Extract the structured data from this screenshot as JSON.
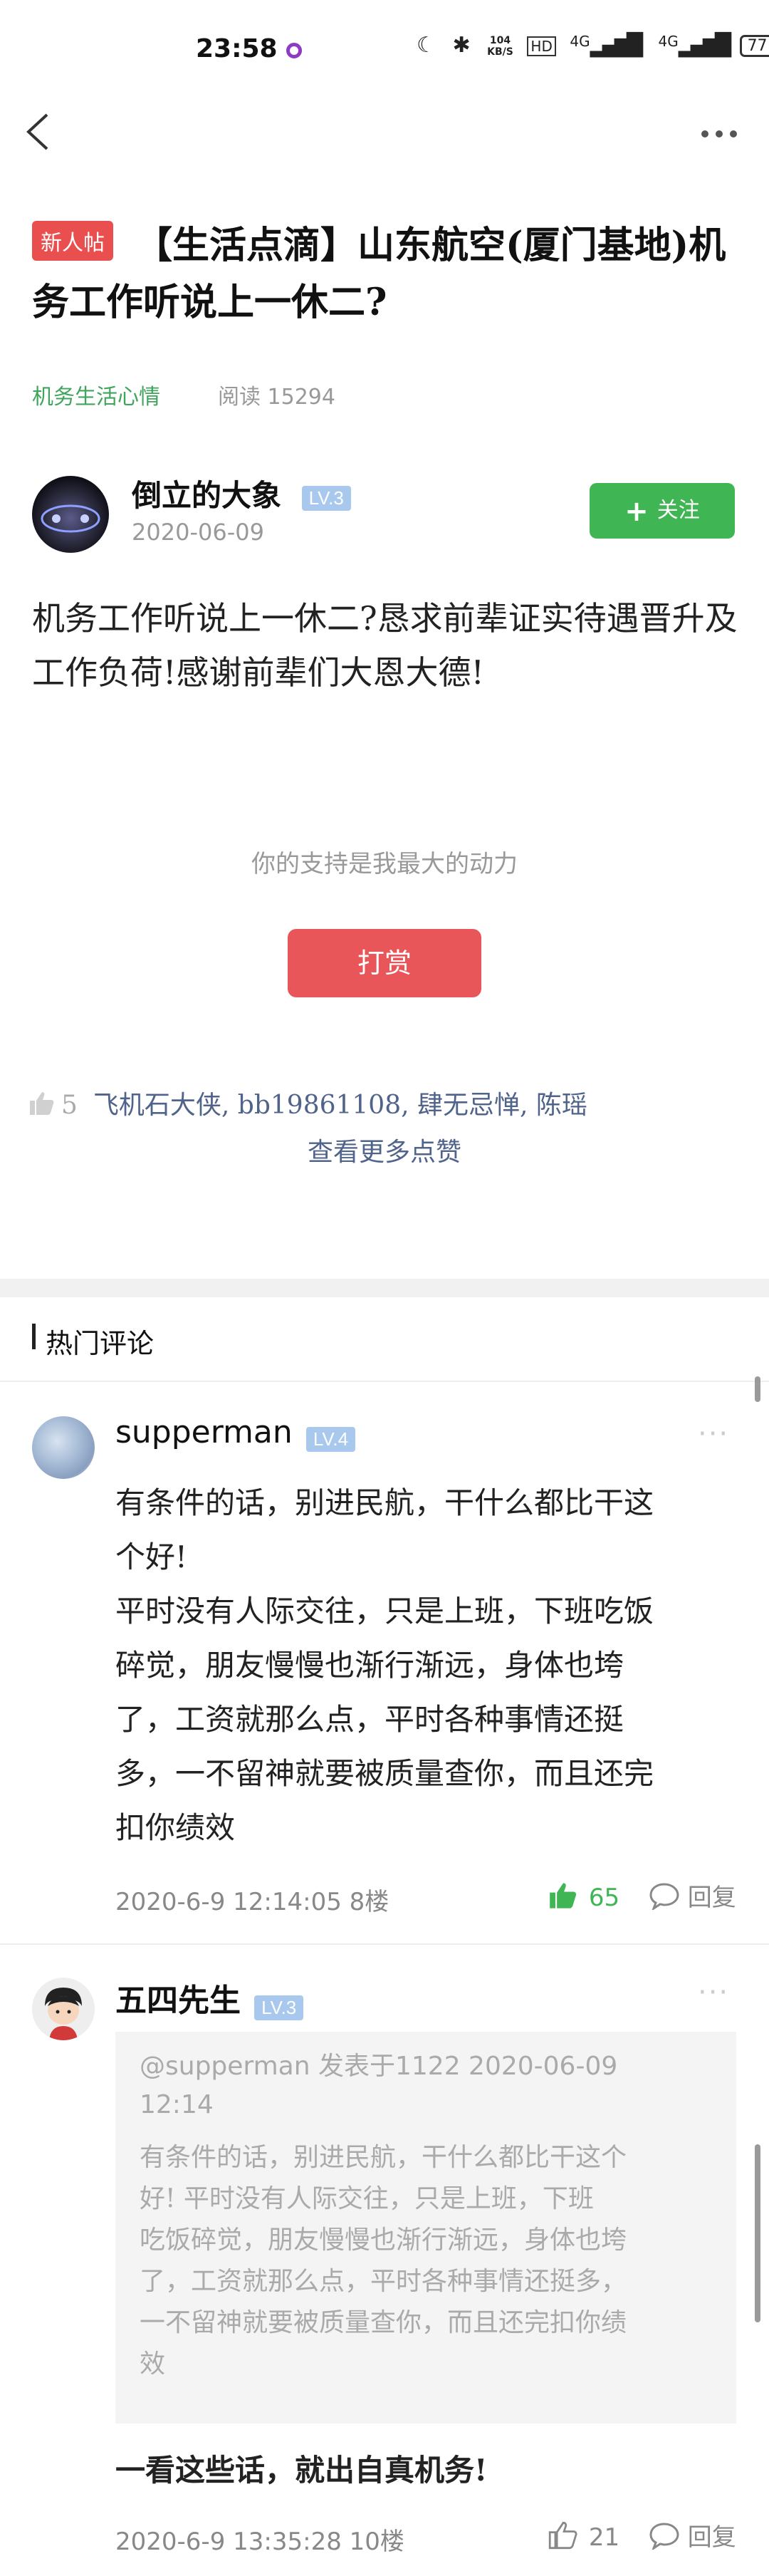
{
  "status_bar": {
    "time": "23:58",
    "speed_value": "104",
    "speed_unit": "KB/S",
    "network_1": "4G",
    "network_2": "4G",
    "battery": "77"
  },
  "nav": {
    "back_icon": "back-arrow-icon",
    "more_icon": "more-dots-icon"
  },
  "post": {
    "tag": "新人帖",
    "title": "【生活点滴】山东航空(厦门基地)机务工作听说上一休二?",
    "category": "机务生活心情",
    "read_label": "阅读 15294",
    "author": {
      "name": "倒立的大象",
      "level": "LV.3",
      "date": "2020-06-09"
    },
    "follow_label": "关注",
    "body": "机务工作听说上一休二?恳求前辈证实待遇晋升及工作负荷!感谢前辈们大恩大德!",
    "support_text": "你的支持是我最大的动力",
    "tip_label": "打赏",
    "like_count": "5",
    "likers": "飞机石大侠, bb19861108, 肆无忌惮, 陈瑶",
    "more_likes": "查看更多点赞"
  },
  "comments_section": {
    "title": "热门评论",
    "comments": [
      {
        "name": "supperman",
        "level": "LV.4",
        "body_lines": [
          "有条件的话，别进民航，干什么都比干这",
          "个好!",
          "平时没有人际交往，只是上班，下班吃饭",
          "碎觉，朋友慢慢也渐行渐远，身体也垮",
          "了，工资就那么点，平时各种事情还挺",
          "多，一不留神就要被质量查你，而且还完",
          "扣你绩效"
        ],
        "meta": "2020-6-9  12:14:05  8楼",
        "likes": "65",
        "reply_label": "回复"
      },
      {
        "name": "五四先生",
        "level": "LV.3",
        "quote_head_1": "@supperman 发表于1122 2020-06-09",
        "quote_head_2": "12:14",
        "quote_lines": [
          "有条件的话，别进民航，干什么都比干这个",
          "好!  平时没有人际交往，只是上班，下班",
          "吃饭碎觉，朋友慢慢也渐行渐远，身体也垮",
          "了，工资就那么点，平时各种事情还挺多，",
          "一不留神就要被质量查你，而且还完扣你绩",
          "效"
        ],
        "body": "一看这些话，就出自真机务!",
        "meta": "2020-6-9  13:35:28  10楼",
        "likes": "21",
        "reply_label": "回复"
      }
    ]
  },
  "colors": {
    "accent_green": "#3fb553",
    "accent_red": "#e9565a",
    "level_badge": "#a9c8ee",
    "link_blue": "#50638a"
  }
}
